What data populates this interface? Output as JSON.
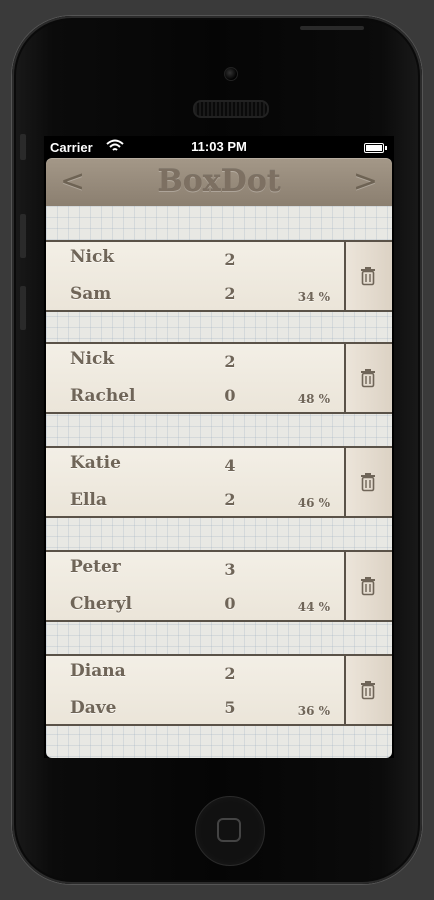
{
  "status_bar": {
    "carrier": "Carrier",
    "time": "11:03 PM"
  },
  "nav": {
    "title": "BoxDot",
    "prev": "<",
    "next": ">"
  },
  "games": [
    {
      "player1": "Nick",
      "score1": "2",
      "player2": "Sam",
      "score2": "2",
      "percent": "34 %"
    },
    {
      "player1": "Nick",
      "score1": "2",
      "player2": "Rachel",
      "score2": "0",
      "percent": "48 %"
    },
    {
      "player1": "Katie",
      "score1": "4",
      "player2": "Ella",
      "score2": "2",
      "percent": "46 %"
    },
    {
      "player1": "Peter",
      "score1": "3",
      "player2": "Cheryl",
      "score2": "0",
      "percent": "44 %"
    },
    {
      "player1": "Diana",
      "score1": "2",
      "player2": "Dave",
      "score2": "5",
      "percent": "36 %"
    }
  ],
  "icons": {
    "delete": "trash-icon",
    "wifi": "wifi-icon",
    "battery": "battery-icon"
  }
}
